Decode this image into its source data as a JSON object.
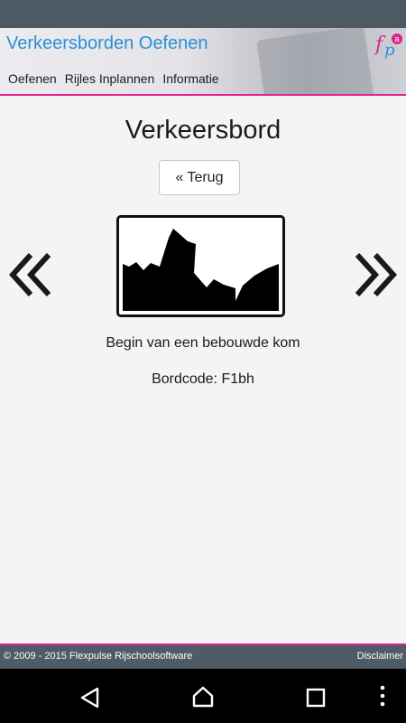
{
  "header": {
    "title": "Verkeersborden Oefenen",
    "logo_letters": [
      "f",
      "p",
      "a"
    ],
    "nav": [
      "Oefenen",
      "Rijles Inplannen",
      "Informatie"
    ]
  },
  "main": {
    "heading": "Verkeersbord",
    "back_label": "Terug",
    "sign_description": "Begin van een bebouwde kom",
    "sign_code": "Bordcode: F1bh"
  },
  "footer": {
    "copyright": "© 2009 - 2015 Flexpulse Rijschoolsoftware",
    "disclaimer": "Disclaimer"
  },
  "colors": {
    "brand_blue": "#2b8fd6",
    "brand_pink": "#e0248c",
    "footer_bg": "#4d5c66",
    "status_bar": "#4b5a63"
  },
  "icons": [
    "prev-arrow-icon",
    "next-arrow-icon",
    "back-icon",
    "home-icon",
    "recents-icon",
    "menu-icon"
  ]
}
